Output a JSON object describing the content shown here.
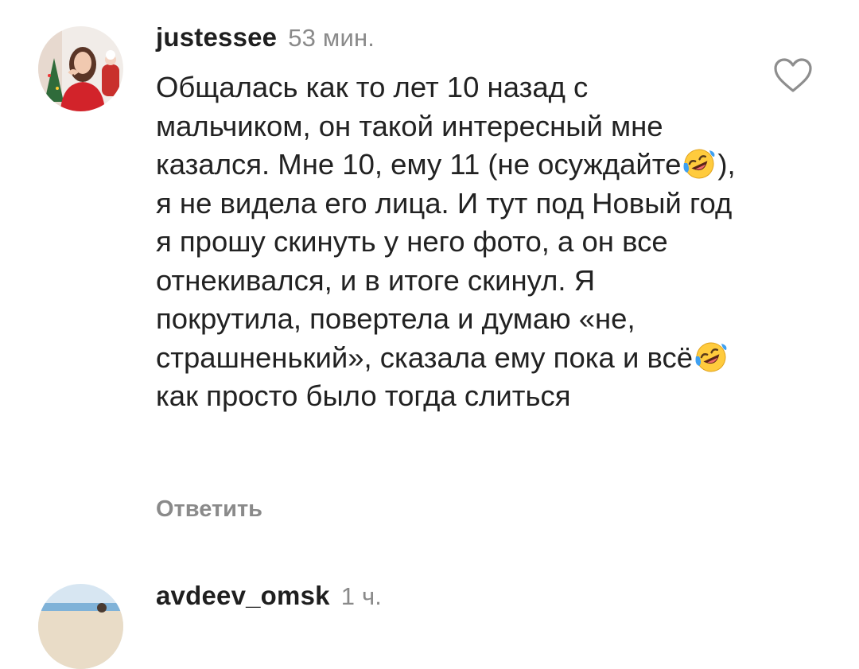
{
  "comments": [
    {
      "username": "justessee",
      "time": "53 мин.",
      "text_segments": [
        "Общалась как то лет 10 назад с мальчиком, он такой интересный мне казался. Мне 10, ему 11 (не осуждайте",
        "), я не видела его лица. И тут под Новый год я прошу скинуть у него фото, а он все отнекивался, и в итоге скинул. Я покрутила, повертела и думаю «не, страшненький», сказала ему пока и всё",
        " как просто было тогда слиться"
      ],
      "emoji": "rolling-on-floor-laughing",
      "reply_label": "Ответить",
      "like_icon": "heart-outline-icon"
    },
    {
      "username": "avdeev_omsk",
      "time": "1 ч."
    }
  ],
  "colors": {
    "username": "#1f1f1f",
    "meta": "#8a8a8a",
    "text": "#222222",
    "emoji_face": "#ffcb3d",
    "emoji_tears": "#3fa0f0"
  }
}
